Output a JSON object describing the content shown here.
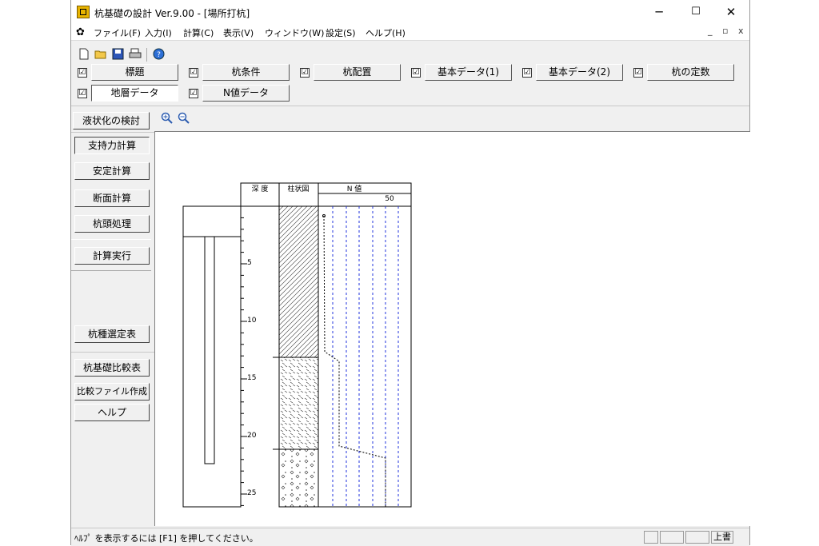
{
  "window": {
    "title": "杭基礎の設計 Ver.9.00 - [場所打杭]",
    "minimize": "─",
    "maximize": "☐",
    "close": "✕"
  },
  "menu": {
    "items": [
      "ファイル(F)",
      "入力(I)",
      "計算(C)",
      "表示(V)",
      "ウィンドウ(W)",
      "設定(S)",
      "ヘルプ(H)"
    ],
    "mdi_minimize": "_",
    "mdi_restore": "ð",
    "mdi_close": "x"
  },
  "toolbar": {
    "icons": [
      "new-file-icon",
      "open-folder-icon",
      "save-icon",
      "print-icon",
      "help-icon"
    ]
  },
  "tabs": {
    "row1": [
      {
        "label": "標題",
        "checked": true
      },
      {
        "label": "杭条件",
        "checked": true
      },
      {
        "label": "杭配置",
        "checked": true
      },
      {
        "label": "基本データ(1)",
        "checked": true
      },
      {
        "label": "基本データ(2)",
        "checked": true
      },
      {
        "label": "杭の定数",
        "checked": true
      }
    ],
    "row2": [
      {
        "label": "地層データ",
        "checked": true
      },
      {
        "label": "N値データ",
        "checked": true
      }
    ],
    "check_mark": "☑"
  },
  "sidebar": {
    "liquefaction": "液状化の検討",
    "bearing": "支持力計算",
    "stability": "安定計算",
    "section": "断面計算",
    "pile_head": "杭頭処理",
    "execute": "計算実行",
    "pile_type_table": "杭種選定表",
    "pile_compare": "杭基礎比較表",
    "compare_file": "比較ファイル作成",
    "help": "ヘルプ"
  },
  "drawing": {
    "col_depth": "深 度",
    "col_column": "柱状図",
    "col_nvalue": "N 値",
    "n_scale": "50",
    "depth_labels": [
      "5",
      "10",
      "15",
      "20",
      "25"
    ]
  },
  "statusbar": {
    "message": "ﾍﾙﾌﾟ を表示するには [F1] を押してください。",
    "mode": "上書"
  }
}
